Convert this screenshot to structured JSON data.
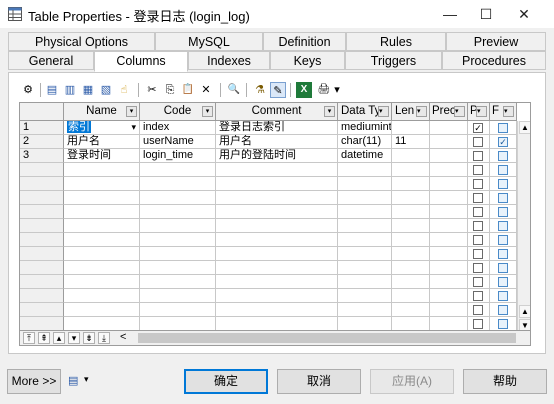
{
  "window": {
    "title": "Table Properties - 登录日志 (login_log)",
    "minimize": "—",
    "maximize": "☐",
    "close": "✕"
  },
  "tabs": {
    "row1": [
      "Physical Options",
      "MySQL",
      "Definition",
      "Rules",
      "Preview"
    ],
    "row2": [
      "General",
      "Columns",
      "Indexes",
      "Keys",
      "Triggers",
      "Procedures"
    ],
    "active": "Columns"
  },
  "toolbar": {
    "icons": [
      "properties-icon",
      "add-row-icon",
      "insert-row-icon",
      "add-rows-icon",
      "copy-row-icon",
      "pointer-icon",
      "cut-icon",
      "copy-icon",
      "paste-icon",
      "delete-icon",
      "find-icon",
      "filter-icon",
      "filter-clear-icon",
      "excel-icon",
      "print-icon",
      "dropdown-icon"
    ],
    "glyphs": [
      "⚙",
      "▤",
      "▥",
      "▦",
      "▧",
      "☝",
      "✂",
      "⎘",
      "📋",
      "✕",
      "🔍",
      "⚗",
      "✎",
      "X",
      "🖨",
      "▾"
    ]
  },
  "grid": {
    "columns": [
      "Name",
      "Code",
      "Comment",
      "Data Ty",
      "Len",
      "Prec",
      "P",
      "F"
    ],
    "rows": [
      {
        "n": "1",
        "name": "索引",
        "code": "index",
        "comment": "登录日志索引",
        "type": "mediumint",
        "len": "",
        "prec": "",
        "p": true,
        "f": false
      },
      {
        "n": "2",
        "name": "用户名",
        "code": "userName",
        "comment": "用户名",
        "type": "char(11)",
        "len": "11",
        "prec": "",
        "p": false,
        "f": true
      },
      {
        "n": "3",
        "name": "登录时间",
        "code": "login_time",
        "comment": "用户的登陆时间",
        "type": "datetime",
        "len": "",
        "prec": "",
        "p": false,
        "f": false
      }
    ],
    "empty_rows": 12,
    "nav": [
      "⤒",
      "⇞",
      "▴",
      "▾",
      "⇟",
      "⤓"
    ],
    "scroll_left": "<"
  },
  "footer": {
    "more": "More >>",
    "ok": "确定",
    "cancel": "取消",
    "apply": "应用(A)",
    "help": "帮助"
  }
}
